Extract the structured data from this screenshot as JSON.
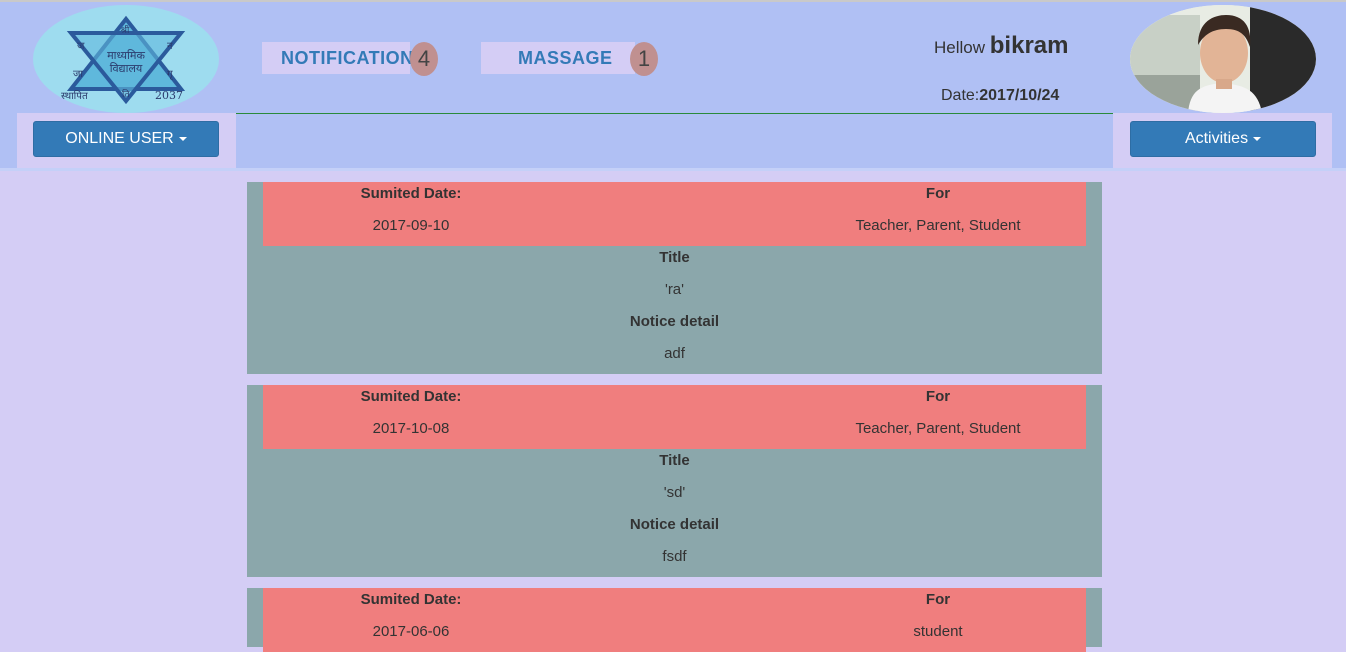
{
  "header": {
    "logo": {
      "top_char": "श्री",
      "corner_tl": "ज",
      "corner_tr": "न",
      "corner_bl": "जा",
      "corner_br": "गृ",
      "center_line1": "माध्यमिक",
      "center_line2": "विद्यालय",
      "bottom_left": "स्थापित",
      "bottom_center": "ति",
      "bottom_right": "2037"
    },
    "notification_label": "NOTIFICATION",
    "notification_count": "4",
    "message_label": "MASSAGE",
    "message_count": "1",
    "greeting": "Hellow",
    "username": "bikram",
    "date_label": "Date:",
    "date_value": "2017/10/24",
    "online_user_label": "ONLINE USER",
    "activities_label": "Activities"
  },
  "colors": {
    "page_bg": "#d4cdf5",
    "header_bg": "#b0c0f4",
    "accent_blue": "#337ab7",
    "notice_head": "#f07e7e",
    "notice_body": "#8ba7ab",
    "badge": "#c09090"
  },
  "notices": [
    {
      "submitted_label": "Sumited Date:",
      "submitted_date": "2017-09-10",
      "for_label": "For",
      "for_value": "Teacher, Parent, Student",
      "title_label": "Title",
      "title_value": "'ra'",
      "detail_label": "Notice detail",
      "detail_value": "adf"
    },
    {
      "submitted_label": "Sumited Date:",
      "submitted_date": "2017-10-08",
      "for_label": "For",
      "for_value": "Teacher, Parent, Student",
      "title_label": "Title",
      "title_value": "'sd'",
      "detail_label": "Notice detail",
      "detail_value": "fsdf"
    },
    {
      "submitted_label": "Sumited Date:",
      "submitted_date": "2017-06-06",
      "for_label": "For",
      "for_value": "student"
    }
  ]
}
